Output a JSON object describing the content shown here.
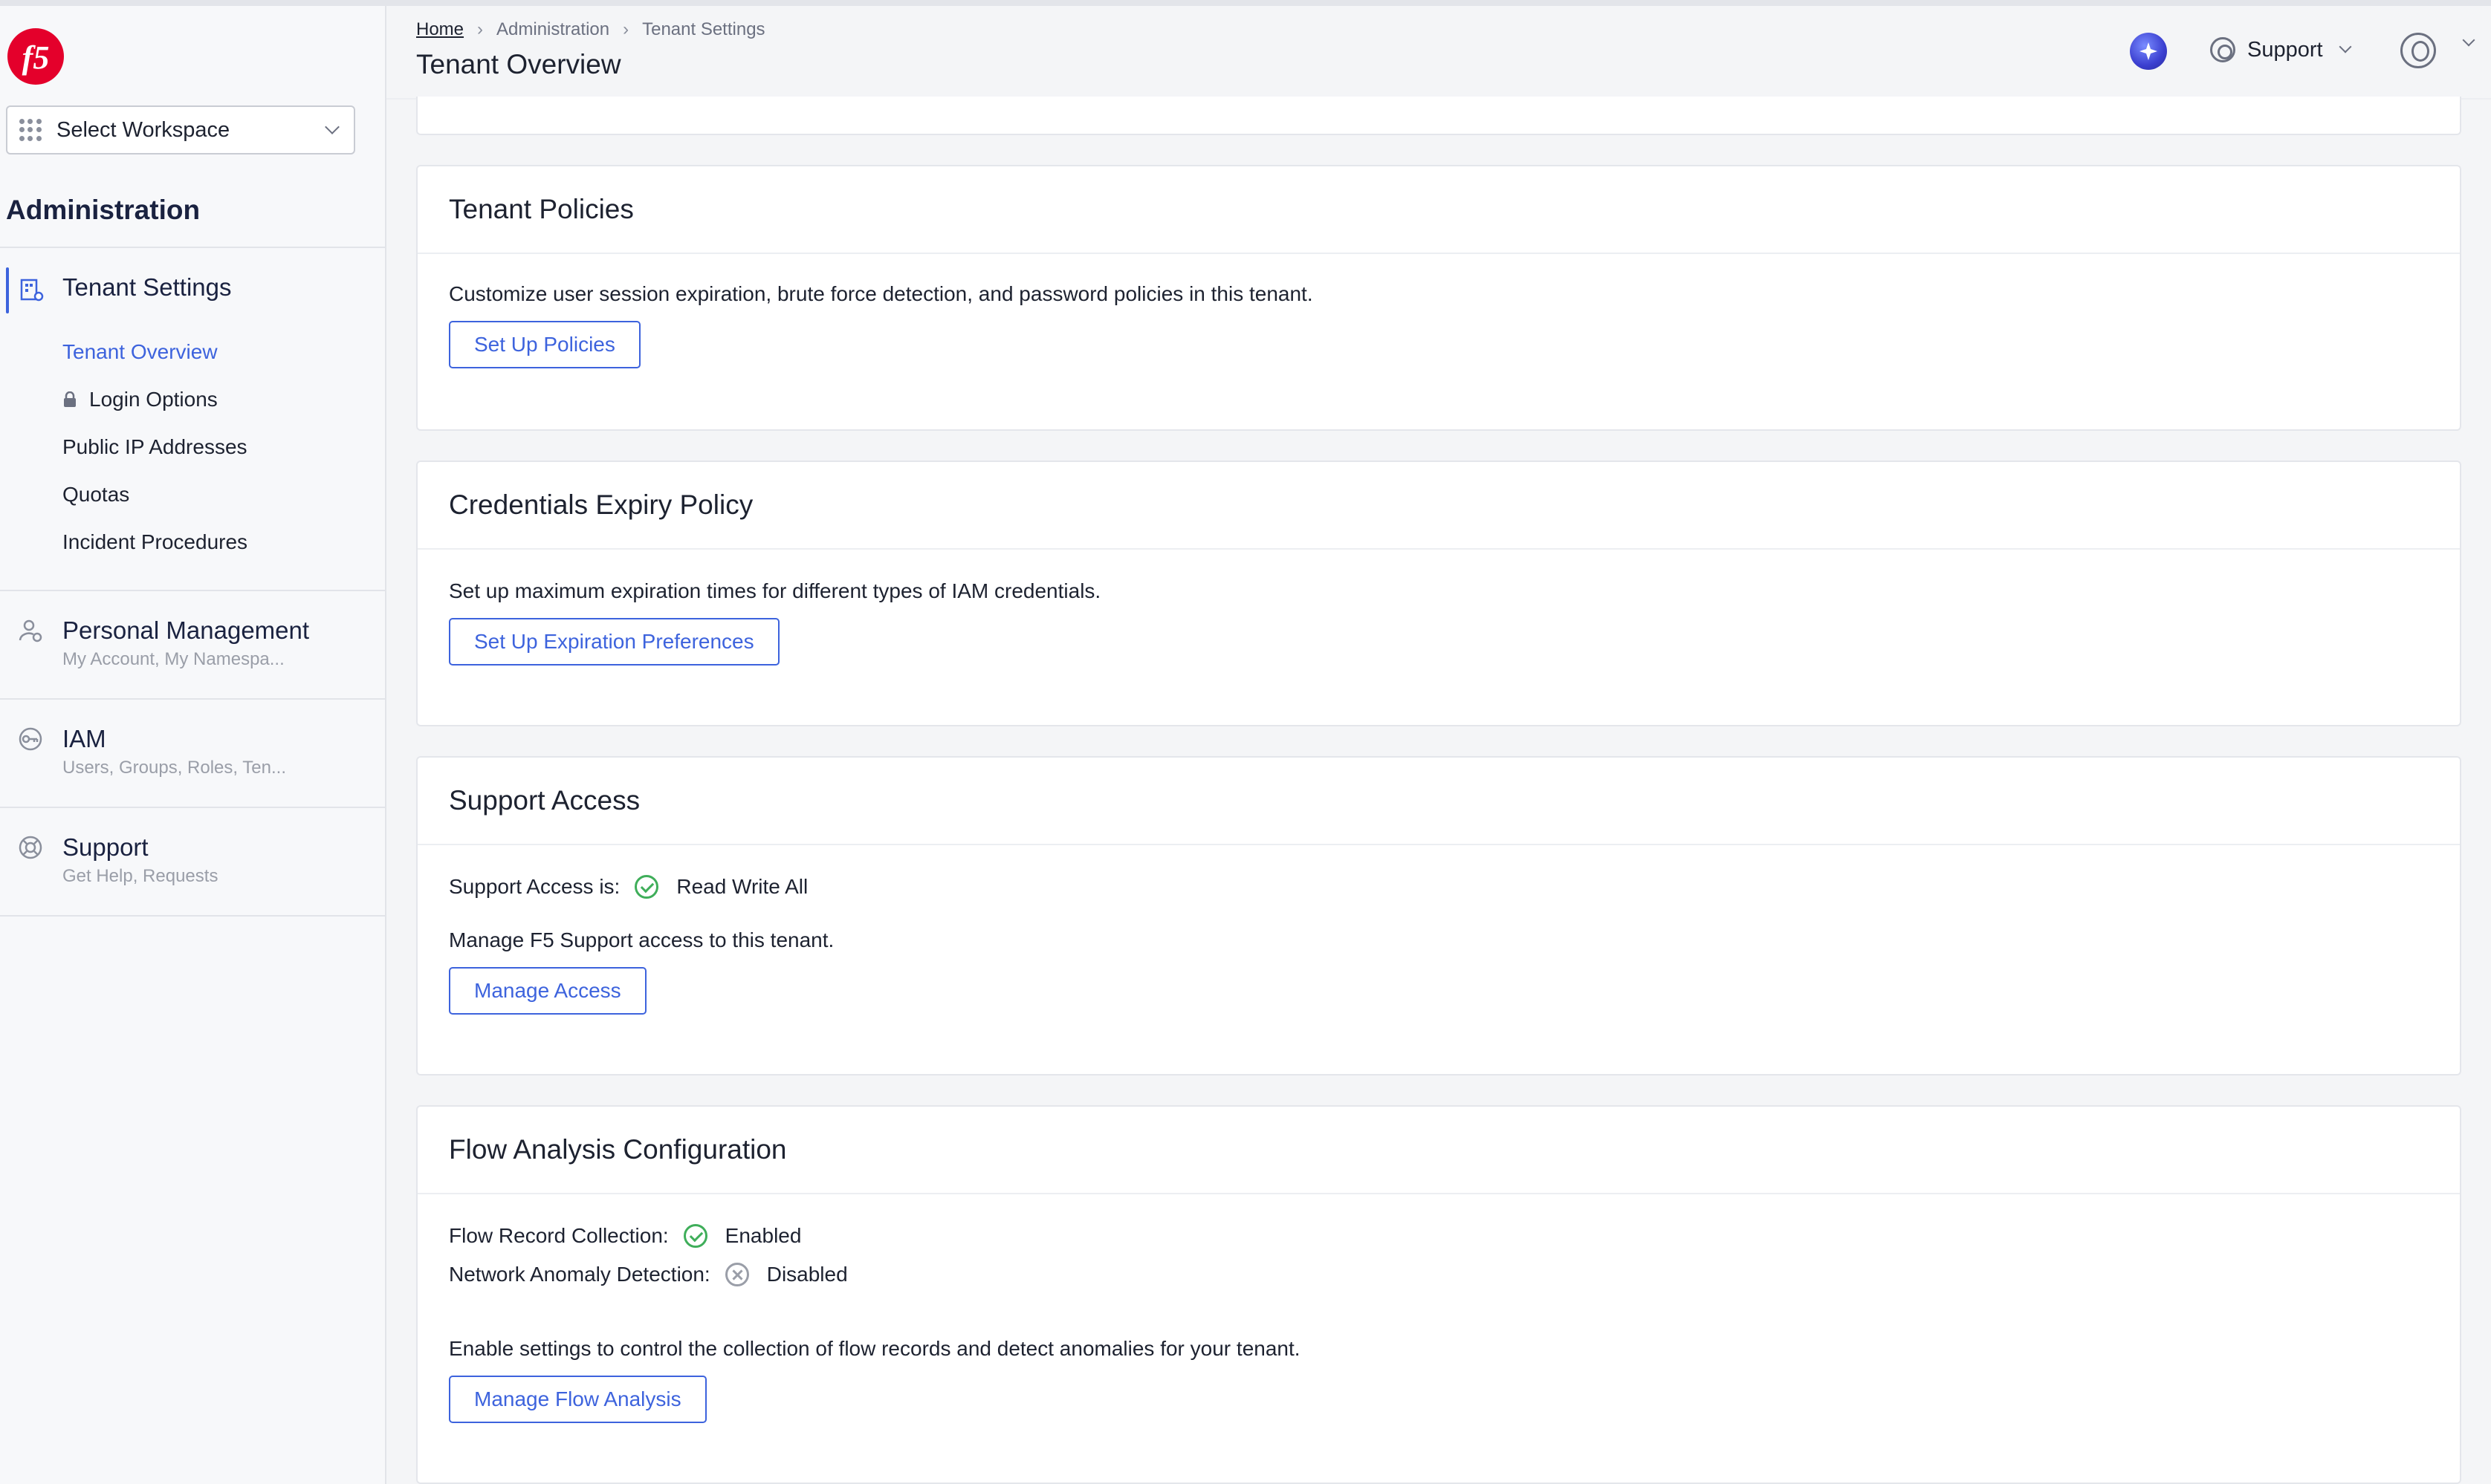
{
  "colors": {
    "accent": "#3d63dd",
    "success": "#3fae5a",
    "brand": "#e4002b"
  },
  "workspace": {
    "label": "Select Workspace"
  },
  "sidebar": {
    "section_title": "Administration",
    "tenant_settings": {
      "label": "Tenant Settings",
      "items": [
        {
          "label": "Tenant Overview",
          "active": true
        },
        {
          "label": "Login Options",
          "locked": true
        },
        {
          "label": "Public IP Addresses"
        },
        {
          "label": "Quotas"
        },
        {
          "label": "Incident Procedures"
        }
      ]
    },
    "groups": [
      {
        "label": "Personal Management",
        "sub": "My Account, My Namespa...",
        "icon": "user-gear-icon"
      },
      {
        "label": "IAM",
        "sub": "Users, Groups, Roles, Ten...",
        "icon": "key-icon"
      },
      {
        "label": "Support",
        "sub": "Get Help, Requests",
        "icon": "lifebuoy-icon"
      }
    ]
  },
  "header": {
    "breadcrumb": [
      "Home",
      "Administration",
      "Tenant Settings"
    ],
    "title": "Tenant Overview",
    "support_label": "Support"
  },
  "cards": {
    "tenant_policies": {
      "title": "Tenant Policies",
      "description": "Customize user session expiration, brute force detection, and password policies in this tenant.",
      "button": "Set Up Policies"
    },
    "credentials_expiry": {
      "title": "Credentials Expiry Policy",
      "description": "Set up maximum expiration times for different types of IAM credentials.",
      "button": "Set Up Expiration Preferences"
    },
    "support_access": {
      "title": "Support Access",
      "status_label": "Support Access is:",
      "status_value": "Read Write All",
      "description": "Manage F5 Support access to this tenant.",
      "button": "Manage Access"
    },
    "flow_analysis": {
      "title": "Flow Analysis Configuration",
      "flow_record_label": "Flow Record Collection:",
      "flow_record_value": "Enabled",
      "anomaly_label": "Network Anomaly Detection:",
      "anomaly_value": "Disabled",
      "description": "Enable settings to control the collection of flow records and detect anomalies for your tenant.",
      "button": "Manage Flow Analysis"
    }
  }
}
